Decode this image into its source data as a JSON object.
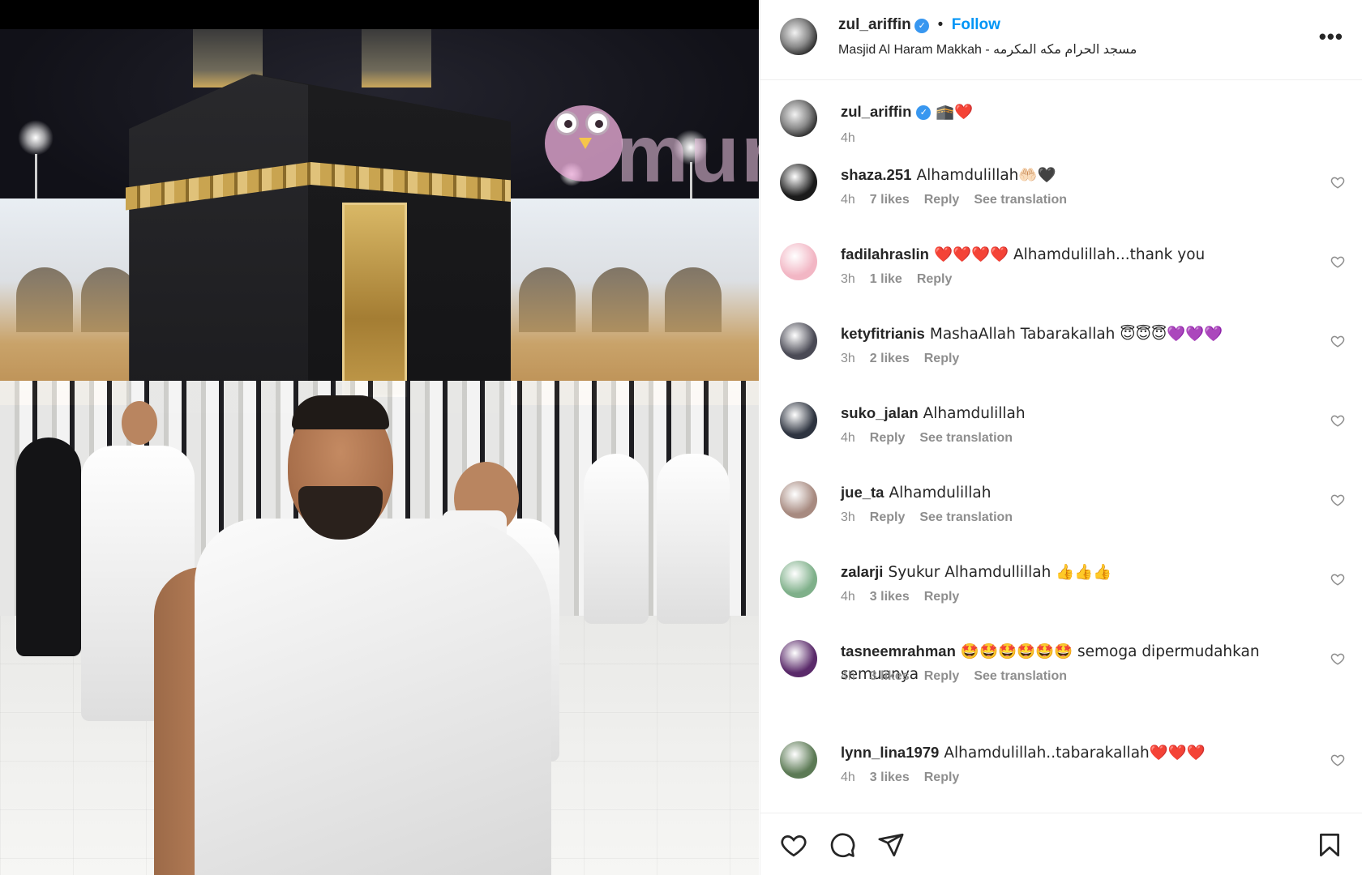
{
  "header": {
    "username": "zul_ariffin",
    "follow_label": "Follow",
    "separator": "•",
    "location": "Masjid Al Haram Makkah - مسجد الحرام مكه المكرمه",
    "more_label": "•••"
  },
  "caption": {
    "username": "zul_ariffin",
    "text": "🕋❤️",
    "time": "4h"
  },
  "watermark": {
    "text": "mural"
  },
  "comments": [
    {
      "username": "shaza.251",
      "text": "Alhamdulillah🤲🏻🖤",
      "time": "4h",
      "likes": "7 likes",
      "reply": "Reply",
      "translation": "See translation",
      "avatar_color": "#1b1b1b"
    },
    {
      "username": "fadilahraslin",
      "text": "❤️❤️❤️❤️ Alhamdulillah...thank you",
      "time": "3h",
      "likes": "1 like",
      "reply": "Reply",
      "translation": "",
      "avatar_color": "#f2b6c4"
    },
    {
      "username": "ketyfitrianis",
      "text": "MashaAllah Tabarakallah 😇😇😇💜💜💜",
      "time": "3h",
      "likes": "2 likes",
      "reply": "Reply",
      "translation": "",
      "avatar_color": "#4a4a55"
    },
    {
      "username": "suko_jalan",
      "text": "Alhamdulillah",
      "time": "4h",
      "likes": "",
      "reply": "Reply",
      "translation": "See translation",
      "avatar_color": "#2e3440"
    },
    {
      "username": "jue_ta",
      "text": "Alhamdulillah",
      "time": "3h",
      "likes": "",
      "reply": "Reply",
      "translation": "See translation",
      "avatar_color": "#a78a80"
    },
    {
      "username": "zalarji",
      "text": "Syukur Alhamdullillah 👍👍👍",
      "time": "4h",
      "likes": "3 likes",
      "reply": "Reply",
      "translation": "",
      "avatar_color": "#7fb08a"
    },
    {
      "username": "tasneemrahman",
      "text": "🤩🤩🤩🤩🤩🤩 semoga dipermudahkan semuanya",
      "time": "4h",
      "likes": "3 likes",
      "reply": "Reply",
      "translation": "See translation",
      "avatar_color": "#5a2a6a"
    },
    {
      "username": "lynn_lina1979",
      "text": "Alhamdulillah..tabarakallah❤️❤️❤️",
      "time": "4h",
      "likes": "3 likes",
      "reply": "Reply",
      "translation": "",
      "avatar_color": "#5c7a55"
    }
  ],
  "actions": {
    "like": "heart-icon",
    "comment": "comment-icon",
    "share": "share-icon",
    "save": "bookmark-icon"
  }
}
